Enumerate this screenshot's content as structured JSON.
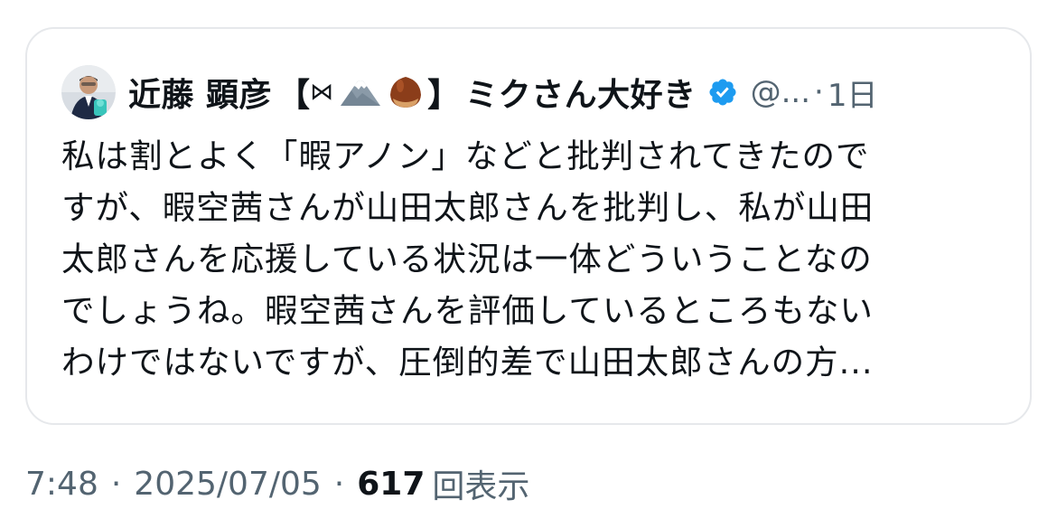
{
  "quote": {
    "author": {
      "name": "近藤 顕彦",
      "bracket_open": "【",
      "decor_symbol": "⋈",
      "bracket_close": "】",
      "suffix": "ミクさん大好き",
      "avatar_icon": "profile-photo",
      "decor_icons": [
        "mountain-icon",
        "chestnut-icon"
      ],
      "verified_icon": "verified-badge-icon",
      "verified_color": "#1d9bf0"
    },
    "handle": "@...",
    "separator": "·",
    "time_ago": "1日",
    "text_lines": [
      "私は割とよく「暇アノン」などと批判されてきたので",
      "すが、暇空茜さんが山田太郎さんを批判し、私が山田",
      "太郎さんを応援している状況は一体どういうことなの",
      "でしょうね。暇空茜さんを評価しているところもない",
      "わけではないですが、圧倒的差で山田太郎さんの方..."
    ]
  },
  "meta": {
    "time": "7:48",
    "separator": "·",
    "date": "2025/07/05",
    "view_count": "617",
    "views_label": "回表示"
  },
  "colors": {
    "text_primary": "#0f1419",
    "text_secondary": "#536471",
    "card_border": "#e6e8eb",
    "verified": "#1d9bf0"
  }
}
